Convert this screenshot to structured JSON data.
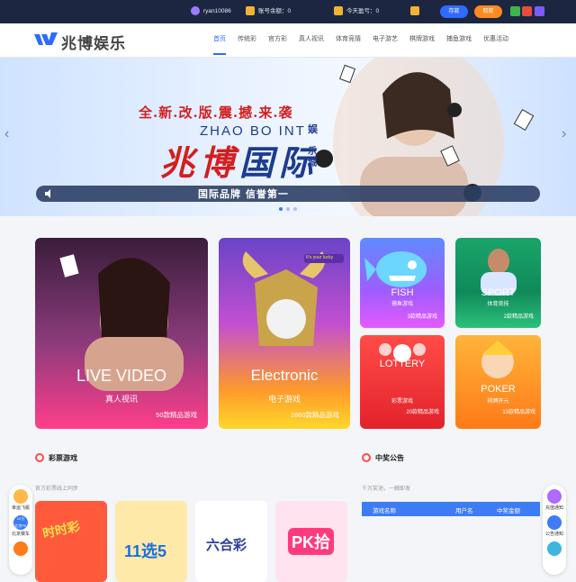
{
  "topbar": {
    "username": "ryan10086",
    "balance_label": "账号余额：0",
    "profit_label": "今天盈亏：0",
    "deposit": "存款",
    "withdraw": "取款"
  },
  "nav": {
    "logo": "兆博娱乐",
    "items": [
      "首页",
      "传统彩",
      "官方彩",
      "真人视讯",
      "体育竞猜",
      "电子游艺",
      "棋牌游戏",
      "捕鱼游戏",
      "优惠活动"
    ]
  },
  "banner": {
    "slogan": "全.新.改.版.震.撼.来.袭",
    "english": "ZHAO BO INT",
    "brand_a": "兆博",
    "brand_b": "国际",
    "suffix_a": "娱",
    "suffix_b": "乐城",
    "tagline": "国际品牌  信誉第一"
  },
  "cards": {
    "live": {
      "title": "LIVE VIDEO",
      "cn": "真人视讯",
      "count": "50款精品游戏"
    },
    "electronic": {
      "title": "Electronic",
      "cn": "电子游戏",
      "count": "1860款精品游戏",
      "badge": "It's your lucky"
    },
    "fish": {
      "title": "FISH",
      "cn": "捕鱼游戏",
      "count": "3款精品游戏"
    },
    "sport": {
      "title": "SPORT",
      "cn": "体育竞技",
      "count": "2款精品游戏"
    },
    "lottery": {
      "title": "LOTTERY",
      "cn": "彩票游戏",
      "count": "20款精品游戏"
    },
    "poker": {
      "title": "POKER",
      "cn": "棋牌开元",
      "count": "13款精品游戏"
    }
  },
  "lottery_section": {
    "title": "彩票游戏",
    "subtitle": "官方彩票线上同步",
    "items": [
      "时时彩",
      "11选5",
      "六合彩",
      "PK拾"
    ]
  },
  "notice_section": {
    "title": "中奖公告",
    "subtitle": "千万奖池，一触即发",
    "columns": [
      "游戏名称",
      "用户名",
      "中奖金额"
    ]
  },
  "float_left": [
    "幸运飞艇",
    "北京赛车"
  ],
  "float_left_badges": [
    "10分",
    "北京PK"
  ],
  "float_right": [
    "充值通知",
    "公告通知"
  ],
  "colors": {
    "nav_dark": "#1d2640",
    "accent": "#2f6bff",
    "withdraw": "#ff8a1f",
    "title_red": "#ff4a4a"
  }
}
